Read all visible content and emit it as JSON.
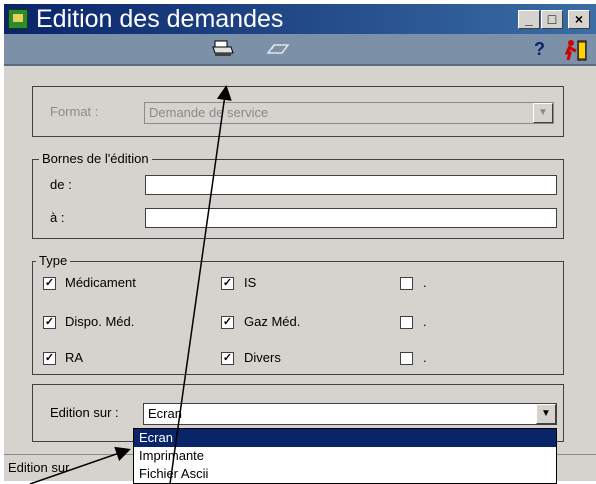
{
  "window": {
    "title": "Edition des demandes"
  },
  "titlebar_buttons": {
    "minimize": "_",
    "maximize": "□",
    "close": "×"
  },
  "toolbar": {
    "help": "?"
  },
  "format": {
    "label": "Format :",
    "value": "Demande de service"
  },
  "bornes": {
    "title": "Bornes de l'édition",
    "de_label": "de :",
    "a_label": "à :",
    "de_value": "",
    "a_value": ""
  },
  "type": {
    "title": "Type",
    "items": [
      {
        "label": "Médicament",
        "checked": true
      },
      {
        "label": "IS",
        "checked": true
      },
      {
        "label": ".",
        "checked": false
      },
      {
        "label": "Dispo. Méd.",
        "checked": true
      },
      {
        "label": "Gaz Méd.",
        "checked": true
      },
      {
        "label": ".",
        "checked": false
      },
      {
        "label": "RA",
        "checked": true
      },
      {
        "label": "Divers",
        "checked": true
      },
      {
        "label": ".",
        "checked": false
      }
    ]
  },
  "edition": {
    "label": "Edition sur :",
    "value": "Ecran",
    "options": [
      "Ecran",
      "Imprimante",
      "Fichier Ascii"
    ],
    "selected": "Ecran"
  },
  "status": {
    "text": "Edition sur"
  },
  "colors": {
    "title_bg": "#0a246a",
    "toolbar_bg": "#7c90a8",
    "selection": "#0a246a",
    "face": "#d6d3ce"
  }
}
